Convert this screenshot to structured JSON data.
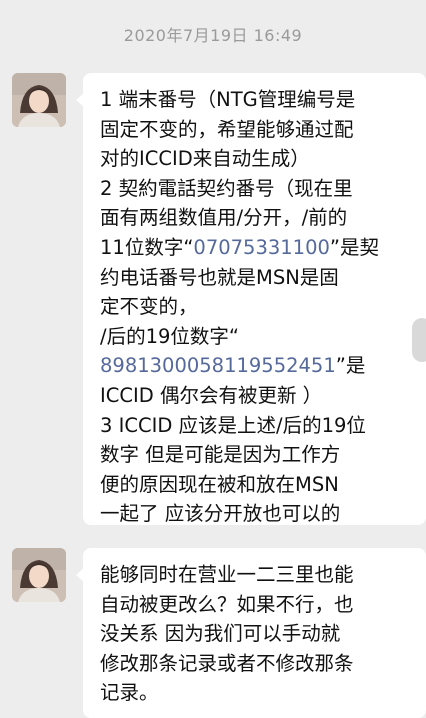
{
  "chat": {
    "timestamp": "2020年7月19日 16:49",
    "messages": [
      {
        "lines": [
          "1 端末番号（NTG管理编号是",
          "固定不变的，希望能够通过配",
          "对的ICCID来自动生成）",
          "2 契約電話契约番号（现在里",
          "面有两组数值用/分开，/前的"
        ],
        "line6_prefix": "11位数字“",
        "phone_number": "07075331100",
        "line6_suffix": "”是契",
        "line7": "约电话番号也就是MSN是固",
        "line8": "定不变的，",
        "line9": "/后的19位数字“",
        "iccid_number": "8981300058119552451",
        "line10_suffix": "”是",
        "lines_tail": [
          "ICCID 偶尔会有被更新 ）",
          "3 ICCID 应该是上述/后的19位",
          "数字 但是可能是因为工作方",
          "便的原因现在被和放在MSN",
          "一起了 应该分开放也可以的"
        ]
      },
      {
        "lines": [
          "能够同时在营业一二三里也能",
          "自动被更改么？如果不行，也",
          "没关系 因为我们可以手动就",
          "修改那条记录或者不修改那条",
          "记录。"
        ]
      }
    ]
  },
  "colors": {
    "background": "#ededed",
    "bubble": "#ffffff",
    "link": "#56699b",
    "timestamp": "#9a9a9a"
  },
  "icons": [
    "avatar"
  ]
}
